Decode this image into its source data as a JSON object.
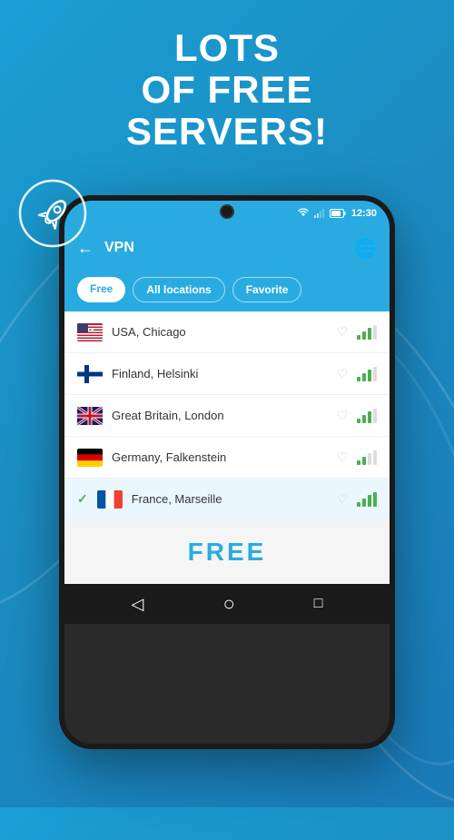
{
  "background": {
    "gradient_start": "#1a9fd4",
    "gradient_end": "#1a7ab8"
  },
  "header": {
    "line1": "Lots",
    "line2": "of free",
    "line3": "servers!"
  },
  "status_bar": {
    "time": "12:30"
  },
  "app_bar": {
    "title": "VPN",
    "back_label": "←",
    "globe_label": "🌐"
  },
  "tabs": [
    {
      "label": "Free",
      "active": true
    },
    {
      "label": "All locations",
      "active": false
    },
    {
      "label": "Favorite",
      "active": false
    }
  ],
  "servers": [
    {
      "country": "USA, Chicago",
      "flag": "usa",
      "selected": false,
      "signal": "medium"
    },
    {
      "country": "Finland, Helsinki",
      "flag": "finland",
      "selected": false,
      "signal": "medium"
    },
    {
      "country": "Great Britain, London",
      "flag": "uk",
      "selected": false,
      "signal": "medium"
    },
    {
      "country": "Germany, Falkenstein",
      "flag": "germany",
      "selected": false,
      "signal": "medium"
    },
    {
      "country": "France, Marseille",
      "flag": "france",
      "selected": true,
      "signal": "good"
    }
  ],
  "free_label": "FREE",
  "nav": {
    "back": "◁",
    "home": "○",
    "recent": "□"
  }
}
